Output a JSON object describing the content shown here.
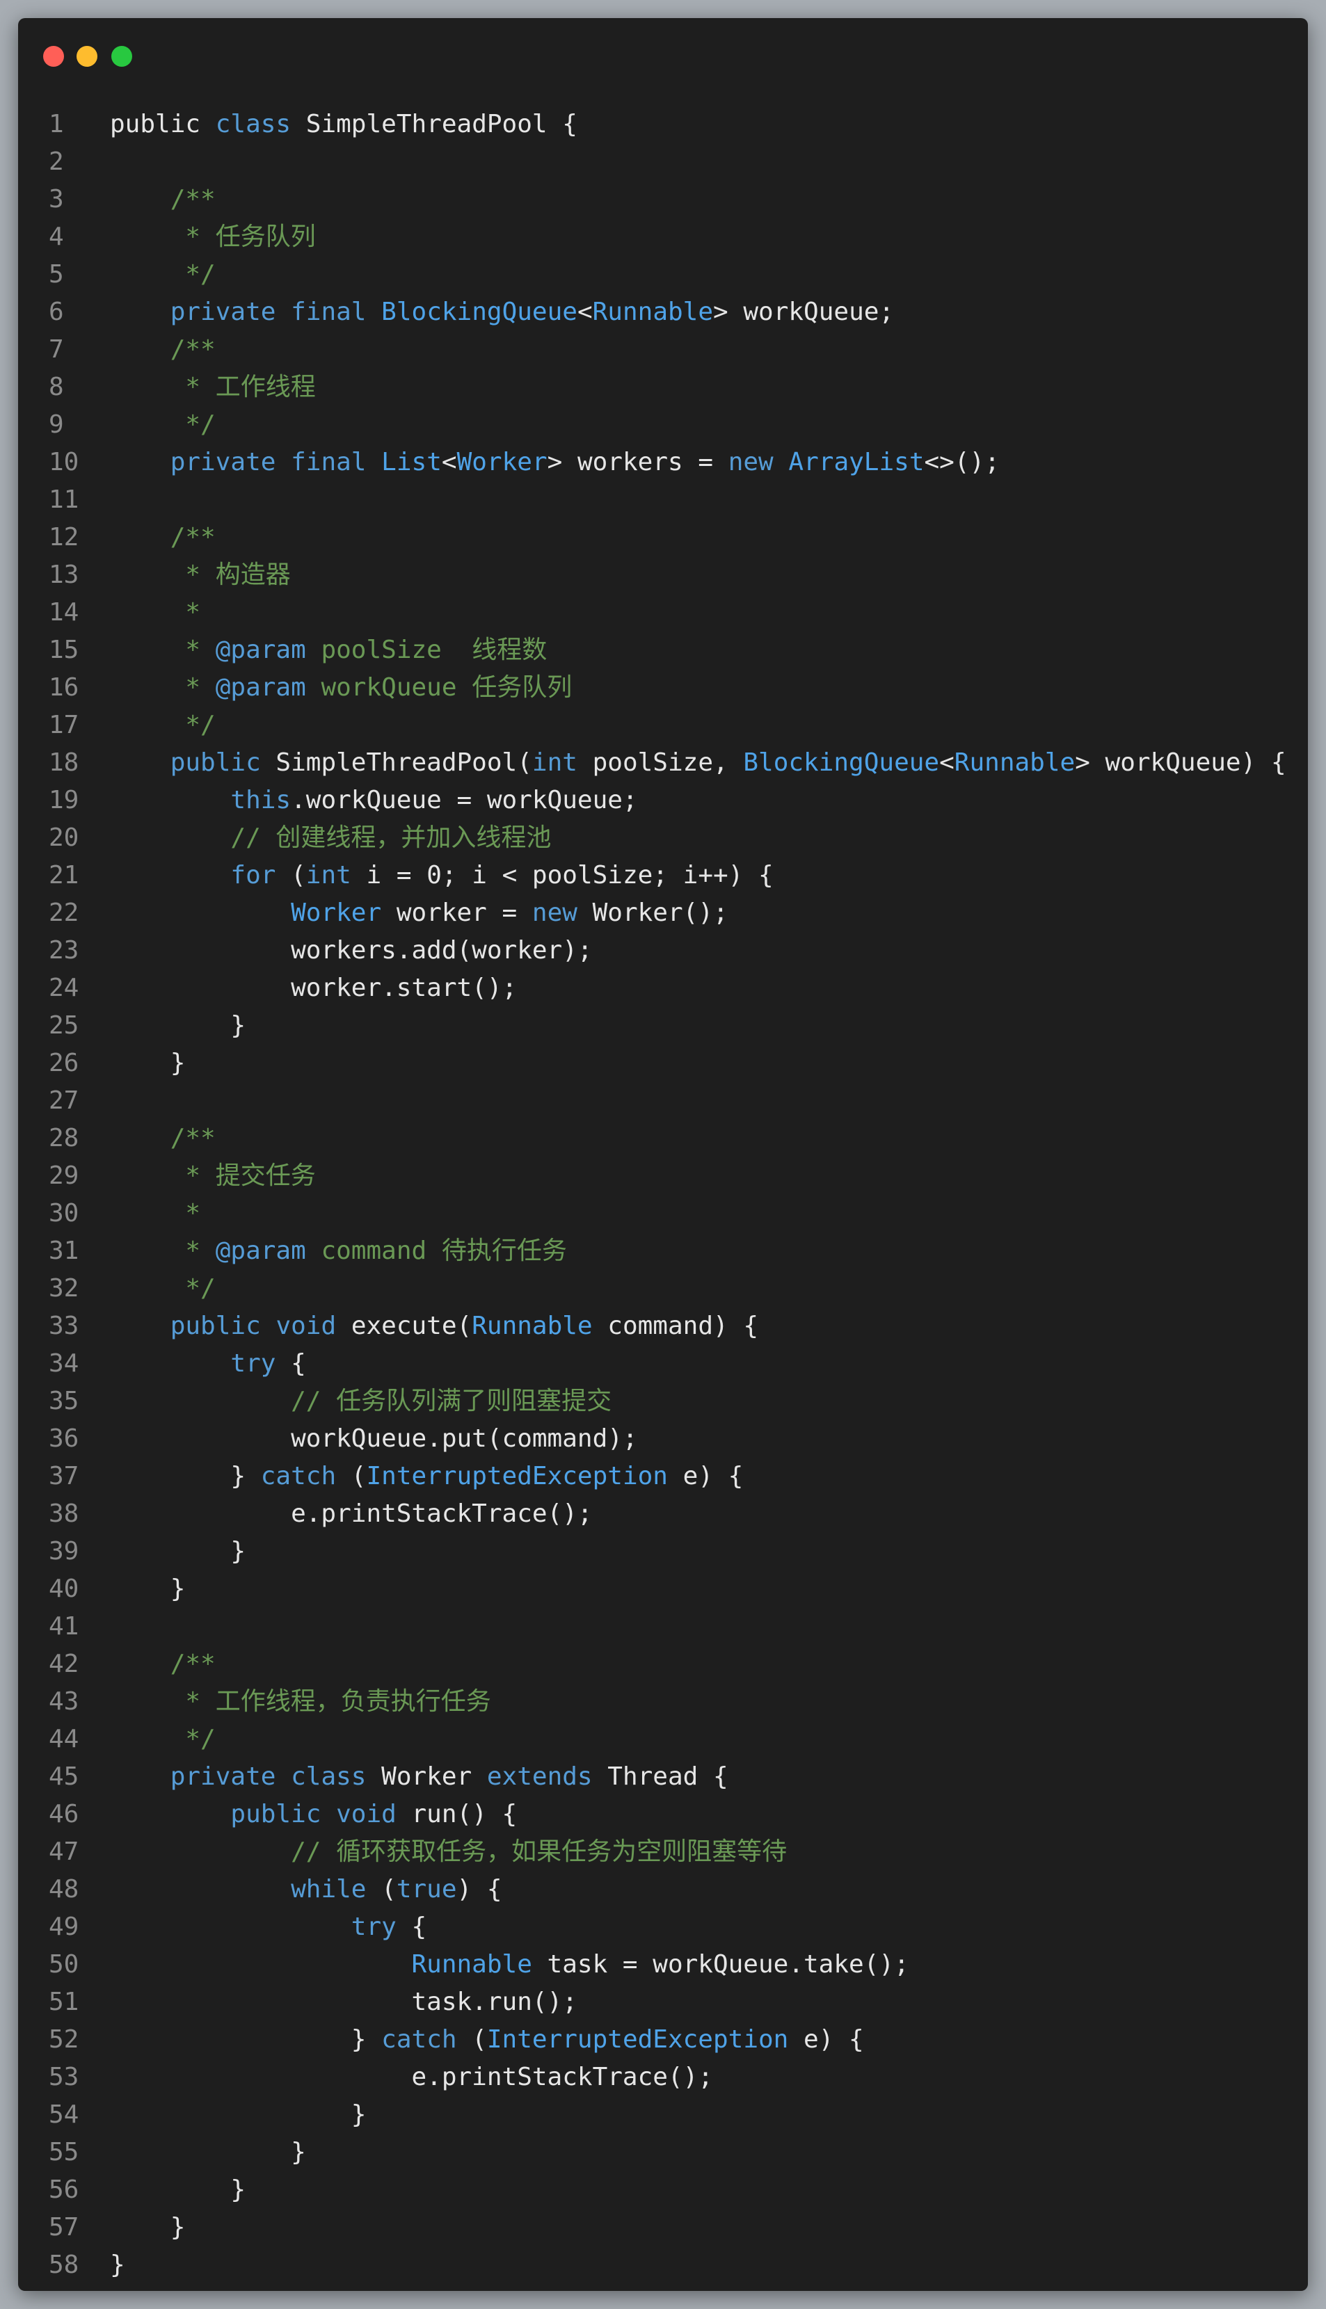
{
  "window": {
    "controls": [
      "close",
      "minimize",
      "maximize"
    ],
    "colors": {
      "close": "#ff5f57",
      "minimize": "#febc2e",
      "maximize": "#28c840",
      "background": "#1e1e1e"
    }
  },
  "code": {
    "language": "java",
    "lines": [
      [
        [
          "pl",
          "public"
        ],
        [
          "pl",
          " "
        ],
        [
          "kw",
          "class"
        ],
        [
          "pl",
          " SimpleThreadPool {"
        ]
      ],
      [],
      [
        [
          "pl",
          "    "
        ],
        [
          "cm",
          "/**"
        ]
      ],
      [
        [
          "pl",
          "     "
        ],
        [
          "cm",
          "* 任务队列"
        ]
      ],
      [
        [
          "pl",
          "     "
        ],
        [
          "cm",
          "*/"
        ]
      ],
      [
        [
          "pl",
          "    "
        ],
        [
          "kw",
          "private"
        ],
        [
          "pl",
          " "
        ],
        [
          "kw",
          "final"
        ],
        [
          "pl",
          " "
        ],
        [
          "ty",
          "BlockingQueue"
        ],
        [
          "pl",
          "<"
        ],
        [
          "ty",
          "Runnable"
        ],
        [
          "pl",
          "> workQueue;"
        ]
      ],
      [
        [
          "pl",
          "    "
        ],
        [
          "cm",
          "/**"
        ]
      ],
      [
        [
          "pl",
          "     "
        ],
        [
          "cm",
          "* 工作线程"
        ]
      ],
      [
        [
          "pl",
          "     "
        ],
        [
          "cm",
          "*/"
        ]
      ],
      [
        [
          "pl",
          "    "
        ],
        [
          "kw",
          "private"
        ],
        [
          "pl",
          " "
        ],
        [
          "kw",
          "final"
        ],
        [
          "pl",
          " "
        ],
        [
          "ty",
          "List"
        ],
        [
          "pl",
          "<"
        ],
        [
          "ty",
          "Worker"
        ],
        [
          "pl",
          "> workers = "
        ],
        [
          "kw",
          "new"
        ],
        [
          "pl",
          " "
        ],
        [
          "ty",
          "ArrayList"
        ],
        [
          "pl",
          "<>();"
        ]
      ],
      [],
      [
        [
          "pl",
          "    "
        ],
        [
          "cm",
          "/**"
        ]
      ],
      [
        [
          "pl",
          "     "
        ],
        [
          "cm",
          "* 构造器"
        ]
      ],
      [
        [
          "pl",
          "     "
        ],
        [
          "cm",
          "*"
        ]
      ],
      [
        [
          "pl",
          "     "
        ],
        [
          "cm",
          "* "
        ],
        [
          "an",
          "@param"
        ],
        [
          "cm",
          " poolSize  线程数"
        ]
      ],
      [
        [
          "pl",
          "     "
        ],
        [
          "cm",
          "* "
        ],
        [
          "an",
          "@param"
        ],
        [
          "cm",
          " workQueue 任务队列"
        ]
      ],
      [
        [
          "pl",
          "     "
        ],
        [
          "cm",
          "*/"
        ]
      ],
      [
        [
          "pl",
          "    "
        ],
        [
          "kw",
          "public"
        ],
        [
          "pl",
          " SimpleThreadPool("
        ],
        [
          "kw",
          "int"
        ],
        [
          "pl",
          " poolSize, "
        ],
        [
          "ty",
          "BlockingQueue"
        ],
        [
          "pl",
          "<"
        ],
        [
          "ty",
          "Runnable"
        ],
        [
          "pl",
          "> workQueue) {"
        ]
      ],
      [
        [
          "pl",
          "        "
        ],
        [
          "kw",
          "this"
        ],
        [
          "pl",
          ".workQueue = workQueue;"
        ]
      ],
      [
        [
          "pl",
          "        "
        ],
        [
          "cm",
          "// 创建线程，并加入线程池"
        ]
      ],
      [
        [
          "pl",
          "        "
        ],
        [
          "kw",
          "for"
        ],
        [
          "pl",
          " ("
        ],
        [
          "kw",
          "int"
        ],
        [
          "pl",
          " i = "
        ],
        [
          "nm",
          "0"
        ],
        [
          "pl",
          "; i < poolSize; i++) {"
        ]
      ],
      [
        [
          "pl",
          "            "
        ],
        [
          "ty",
          "Worker"
        ],
        [
          "pl",
          " worker = "
        ],
        [
          "kw",
          "new"
        ],
        [
          "pl",
          " Worker();"
        ]
      ],
      [
        [
          "pl",
          "            workers.add(worker);"
        ]
      ],
      [
        [
          "pl",
          "            worker.start();"
        ]
      ],
      [
        [
          "pl",
          "        }"
        ]
      ],
      [
        [
          "pl",
          "    }"
        ]
      ],
      [],
      [
        [
          "pl",
          "    "
        ],
        [
          "cm",
          "/**"
        ]
      ],
      [
        [
          "pl",
          "     "
        ],
        [
          "cm",
          "* 提交任务"
        ]
      ],
      [
        [
          "pl",
          "     "
        ],
        [
          "cm",
          "*"
        ]
      ],
      [
        [
          "pl",
          "     "
        ],
        [
          "cm",
          "* "
        ],
        [
          "an",
          "@param"
        ],
        [
          "cm",
          " command 待执行任务"
        ]
      ],
      [
        [
          "pl",
          "     "
        ],
        [
          "cm",
          "*/"
        ]
      ],
      [
        [
          "pl",
          "    "
        ],
        [
          "kw",
          "public"
        ],
        [
          "pl",
          " "
        ],
        [
          "kw",
          "void"
        ],
        [
          "pl",
          " execute("
        ],
        [
          "ty",
          "Runnable"
        ],
        [
          "pl",
          " command) {"
        ]
      ],
      [
        [
          "pl",
          "        "
        ],
        [
          "kw",
          "try"
        ],
        [
          "pl",
          " {"
        ]
      ],
      [
        [
          "pl",
          "            "
        ],
        [
          "cm",
          "// 任务队列满了则阻塞提交"
        ]
      ],
      [
        [
          "pl",
          "            workQueue.put(command);"
        ]
      ],
      [
        [
          "pl",
          "        } "
        ],
        [
          "kw",
          "catch"
        ],
        [
          "pl",
          " ("
        ],
        [
          "ty",
          "InterruptedException"
        ],
        [
          "pl",
          " e) {"
        ]
      ],
      [
        [
          "pl",
          "            e.printStackTrace();"
        ]
      ],
      [
        [
          "pl",
          "        }"
        ]
      ],
      [
        [
          "pl",
          "    }"
        ]
      ],
      [],
      [
        [
          "pl",
          "    "
        ],
        [
          "cm",
          "/**"
        ]
      ],
      [
        [
          "pl",
          "     "
        ],
        [
          "cm",
          "* 工作线程，负责执行任务"
        ]
      ],
      [
        [
          "pl",
          "     "
        ],
        [
          "cm",
          "*/"
        ]
      ],
      [
        [
          "pl",
          "    "
        ],
        [
          "kw",
          "private"
        ],
        [
          "pl",
          " "
        ],
        [
          "kw",
          "class"
        ],
        [
          "pl",
          " Worker "
        ],
        [
          "kw",
          "extends"
        ],
        [
          "pl",
          " Thread {"
        ]
      ],
      [
        [
          "pl",
          "        "
        ],
        [
          "kw",
          "public"
        ],
        [
          "pl",
          " "
        ],
        [
          "kw",
          "void"
        ],
        [
          "pl",
          " run() {"
        ]
      ],
      [
        [
          "pl",
          "            "
        ],
        [
          "cm",
          "// 循环获取任务，如果任务为空则阻塞等待"
        ]
      ],
      [
        [
          "pl",
          "            "
        ],
        [
          "kw",
          "while"
        ],
        [
          "pl",
          " ("
        ],
        [
          "kw",
          "true"
        ],
        [
          "pl",
          ") {"
        ]
      ],
      [
        [
          "pl",
          "                "
        ],
        [
          "kw",
          "try"
        ],
        [
          "pl",
          " {"
        ]
      ],
      [
        [
          "pl",
          "                    "
        ],
        [
          "ty",
          "Runnable"
        ],
        [
          "pl",
          " task = workQueue.take();"
        ]
      ],
      [
        [
          "pl",
          "                    task.run();"
        ]
      ],
      [
        [
          "pl",
          "                } "
        ],
        [
          "kw",
          "catch"
        ],
        [
          "pl",
          " ("
        ],
        [
          "ty",
          "InterruptedException"
        ],
        [
          "pl",
          " e) {"
        ]
      ],
      [
        [
          "pl",
          "                    e.printStackTrace();"
        ]
      ],
      [
        [
          "pl",
          "                }"
        ]
      ],
      [
        [
          "pl",
          "            }"
        ]
      ],
      [
        [
          "pl",
          "        }"
        ]
      ],
      [
        [
          "pl",
          "    }"
        ]
      ],
      [
        [
          "pl",
          "}"
        ]
      ]
    ]
  }
}
